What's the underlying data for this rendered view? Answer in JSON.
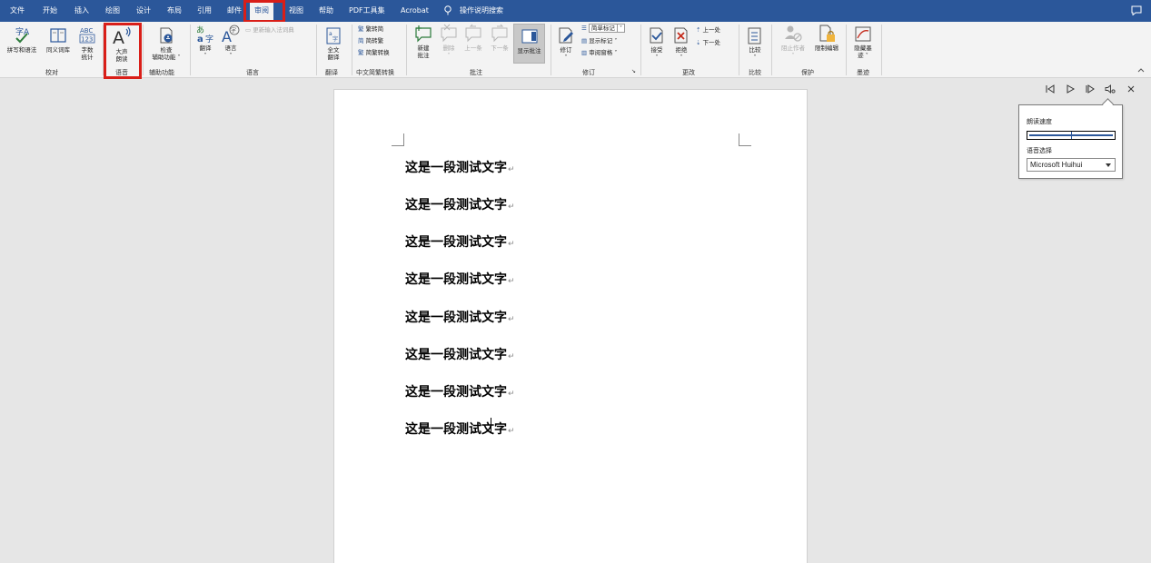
{
  "menu": {
    "tabs": [
      "文件",
      "开始",
      "插入",
      "绘图",
      "设计",
      "布局",
      "引用",
      "邮件",
      "审阅",
      "视图",
      "帮助",
      "PDF工具集",
      "Acrobat"
    ],
    "tell_me": "操作说明搜索"
  },
  "ribbon": {
    "proofing": {
      "spelling": "拼写和语法",
      "thesaurus": "同义词库",
      "word_count_1": "字数",
      "word_count_2": "统计",
      "label": "校对"
    },
    "speech": {
      "read_aloud_1": "大声",
      "read_aloud_2": "朗读",
      "label": "语音"
    },
    "accessibility": {
      "check_1": "检查",
      "check_2": "辅助功能 ˅",
      "label": "辅助功能"
    },
    "language": {
      "translate": "翻译",
      "language": "语言",
      "update_ime": "更新输入法词典",
      "label": "语言"
    },
    "translate_group": {
      "full_1": "全文",
      "full_2": "翻译",
      "label": "翻译"
    },
    "chinese_conversion": {
      "to_trad": "繁转简",
      "to_simp": "简转繁",
      "convert": "简繁转换",
      "label": "中文简繁转换"
    },
    "comments": {
      "new_1": "新建",
      "new_2": "批注",
      "delete": "删除",
      "prev": "上一条",
      "next": "下一条",
      "show": "显示批注",
      "label": "批注"
    },
    "tracking": {
      "track": "修订",
      "simple_markup": "简单标记",
      "show_markup": "显示标记 ˅",
      "review_pane": "审阅窗格 ˅",
      "label": "修订"
    },
    "changes": {
      "accept": "接受",
      "reject": "拒绝",
      "previous": "上一处",
      "next": "下一处",
      "label": "更改"
    },
    "compare": {
      "compare": "比较",
      "label": "比较"
    },
    "protect": {
      "block_authors": "阻止作者",
      "restrict": "限制编辑",
      "label": "保护"
    },
    "ink": {
      "hide_1": "隐藏墨",
      "hide_2": "迹 ˅",
      "label": "墨迹"
    }
  },
  "document": {
    "lines": [
      "这是一段测试文字",
      "这是一段测试文字",
      "这是一段测试文字",
      "这是一段测试文字",
      "这是一段测试文字",
      "这是一段测试文字",
      "这是一段测试文字",
      "这是一段测试文字"
    ],
    "paragraph_mark": "↵"
  },
  "read_aloud": {
    "speed_label": "朗读速度",
    "speed_value": 0.5,
    "voice_label": "语音选择",
    "voice_value": "Microsoft Huihui"
  },
  "colors": {
    "accent": "#2b579a",
    "highlight": "#d91e18"
  }
}
